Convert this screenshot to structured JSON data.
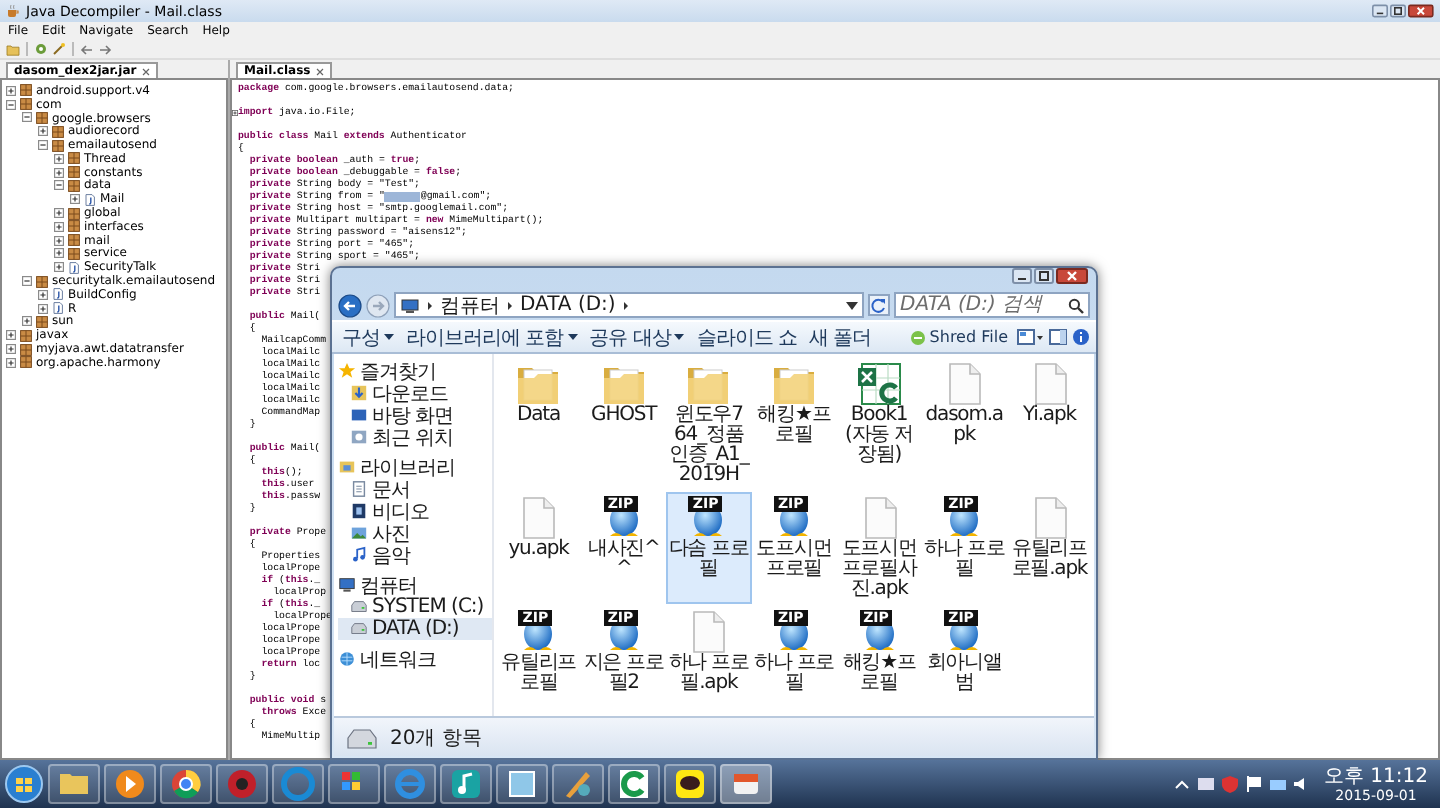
{
  "window": {
    "title": "Java Decompiler - Mail.class"
  },
  "menu": [
    "File",
    "Edit",
    "Navigate",
    "Search",
    "Help"
  ],
  "left_tab": {
    "label": "dasom_dex2jar.jar",
    "selected": true
  },
  "tree": [
    {
      "label": "android.support.v4",
      "kind": "package",
      "expanded": false
    },
    {
      "label": "com",
      "kind": "package",
      "expanded": true,
      "children": [
        {
          "label": "google.browsers",
          "kind": "package",
          "expanded": true,
          "children": [
            {
              "label": "audiorecord",
              "kind": "package",
              "expanded": false
            },
            {
              "label": "emailautosend",
              "kind": "package",
              "expanded": true,
              "children": [
                {
                  "label": "Thread",
                  "kind": "package",
                  "expanded": false
                },
                {
                  "label": "constants",
                  "kind": "package",
                  "expanded": false
                },
                {
                  "label": "data",
                  "kind": "package",
                  "expanded": true,
                  "children": [
                    {
                      "label": "Mail",
                      "kind": "class",
                      "expanded": false
                    }
                  ]
                },
                {
                  "label": "global",
                  "kind": "package",
                  "expanded": false
                },
                {
                  "label": "interfaces",
                  "kind": "package",
                  "expanded": false
                },
                {
                  "label": "mail",
                  "kind": "package",
                  "expanded": false
                },
                {
                  "label": "service",
                  "kind": "package",
                  "expanded": false
                },
                {
                  "label": "SecurityTalk",
                  "kind": "class",
                  "expanded": false
                }
              ]
            }
          ]
        },
        {
          "label": "securitytalk.emailautosend",
          "kind": "package",
          "expanded": true,
          "children": [
            {
              "label": "BuildConfig",
              "kind": "class",
              "expanded": false
            },
            {
              "label": "R",
              "kind": "class",
              "expanded": false
            }
          ]
        },
        {
          "label": "sun",
          "kind": "package",
          "expanded": false
        }
      ]
    },
    {
      "label": "javax",
      "kind": "package",
      "expanded": false
    },
    {
      "label": "myjava.awt.datatransfer",
      "kind": "package",
      "expanded": false
    },
    {
      "label": "org.apache.harmony",
      "kind": "package",
      "expanded": false
    }
  ],
  "editor_tab": {
    "label": "Mail.class",
    "selected": true
  },
  "code": {
    "blocks": [
      {
        "folded": false,
        "lines": [
          "**package** com.google.browsers.emailautosend.data;"
        ]
      },
      {
        "folded": true,
        "lines": [
          "**import** java.io.File;"
        ]
      },
      {
        "folded": false,
        "lines": [
          "**public class** Mail **extends** Authenticator",
          "{",
          "  **private boolean** _auth = **true**;",
          "  **private boolean** _debuggable = **false**;",
          "  **private** String body = \"Test\";",
          {
            "kind": "selection",
            "before": "  **private** String from = \"",
            "after": "@gmail.com\";"
          },
          "  **private** String host = \"smtp.googlemail.com\";",
          "  **private** Multipart multipart = **new** MimeMultipart();",
          "  **private** String password = \"aisens12\";",
          "  **private** String port = \"465\";",
          "  **private** String sport = \"465\";",
          "  **private** Stri",
          "  **private** Stri",
          "  **private** Stri"
        ]
      },
      {
        "folded": false,
        "lines": [
          "  **public** Mail(",
          "  {",
          "    MailcapComm",
          "    localMailc",
          "    localMailc",
          "    localMailc",
          "    localMailc",
          "    localMailc",
          "    CommandMap",
          "  }"
        ]
      },
      {
        "folded": false,
        "lines": [
          "  **public** Mail(",
          "  {",
          "    **this**();",
          "    **this**.user",
          "    **this**.passw",
          "  }"
        ]
      },
      {
        "folded": false,
        "lines": [
          "  **private** Prope",
          "  {",
          "    Properties",
          "    localPrope",
          "    **if** (**this**._",
          "      localProp",
          "    **if** (**this**._",
          "      localPrope",
          "    localPrope",
          "    localPrope",
          "    localPrope",
          "    **return** loc",
          "  }"
        ]
      },
      {
        "folded": false,
        "lines": [
          "  **public void** s",
          "    **throws** Exce",
          "  {",
          "    MimeMultip"
        ]
      }
    ]
  },
  "explorer": {
    "address": [
      "컴퓨터",
      "DATA (D:)"
    ],
    "search": {
      "placeholder": "DATA (D:) 검색"
    },
    "toolbar": [
      {
        "label": "구성",
        "dropdown": true
      },
      {
        "label": "라이브러리에 포함",
        "dropdown": true
      },
      {
        "label": "공유 대상",
        "dropdown": true
      },
      {
        "label": "슬라이드 쇼",
        "dropdown": false
      },
      {
        "label": "새 폴더",
        "dropdown": false
      }
    ],
    "shred_button": "Shred File",
    "nav": [
      {
        "label": "즐겨찾기",
        "kind": "favorites",
        "selected": false,
        "children": [
          {
            "label": "다운로드",
            "kind": "download",
            "selected": false
          },
          {
            "label": "바탕 화면",
            "kind": "desktop",
            "selected": false
          },
          {
            "label": "최근 위치",
            "kind": "recent",
            "selected": false
          }
        ]
      },
      {
        "label": "라이브러리",
        "kind": "library",
        "selected": false,
        "children": [
          {
            "label": "문서",
            "kind": "document",
            "selected": false
          },
          {
            "label": "비디오",
            "kind": "video",
            "selected": false
          },
          {
            "label": "사진",
            "kind": "picture",
            "selected": false
          },
          {
            "label": "음악",
            "kind": "music",
            "selected": false
          }
        ]
      },
      {
        "label": "컴퓨터",
        "kind": "computer",
        "selected": false,
        "children": [
          {
            "label": "SYSTEM (C:)",
            "kind": "drive",
            "selected": false
          },
          {
            "label": "DATA (D:)",
            "kind": "drive",
            "selected": true
          }
        ]
      },
      {
        "label": "네트워크",
        "kind": "network",
        "selected": false
      }
    ],
    "files": [
      {
        "label": "Data",
        "kind": "folder",
        "selected": false
      },
      {
        "label": "GHOST",
        "kind": "folder",
        "selected": false
      },
      {
        "label": "윈도우7 64_정품인증_A1_2019H",
        "kind": "folder",
        "selected": false
      },
      {
        "label": "해킹★프로필",
        "kind": "folder",
        "selected": false
      },
      {
        "label": "Book1 (자동 저장됨)",
        "kind": "excel",
        "selected": false
      },
      {
        "label": "dasom.apk",
        "kind": "file",
        "selected": false
      },
      {
        "label": "Yi.apk",
        "kind": "file",
        "selected": false
      },
      {
        "label": "yu.apk",
        "kind": "file",
        "selected": false
      },
      {
        "label": "내사진^^",
        "kind": "zip",
        "badge": "ZIP",
        "selected": false
      },
      {
        "label": "다솜 프로필",
        "kind": "zip",
        "badge": "ZIP",
        "selected": true
      },
      {
        "label": "도프시먼프로필",
        "kind": "zip",
        "badge": "ZIP",
        "selected": false
      },
      {
        "label": "도프시먼프로필사진.apk",
        "kind": "file",
        "selected": false
      },
      {
        "label": "하나 프로필",
        "kind": "zip",
        "badge": "ZIP",
        "selected": false
      },
      {
        "label": "유틸리프로필.apk",
        "kind": "file",
        "selected": false
      },
      {
        "label": "유틸리프로필",
        "kind": "zip",
        "badge": "ZIP",
        "selected": false
      },
      {
        "label": "지은 프로필2",
        "kind": "zip",
        "badge": "ZIP",
        "selected": false
      },
      {
        "label": "하나 프로필.apk",
        "kind": "file",
        "selected": false
      },
      {
        "label": "하나 프로필",
        "kind": "zip",
        "badge": "ZIP",
        "selected": false
      },
      {
        "label": "해킹★프로필",
        "kind": "zip",
        "badge": "ZIP",
        "selected": false
      },
      {
        "label": "회아니앨범",
        "kind": "zip",
        "badge": "ZIP",
        "selected": false
      }
    ],
    "status": "20개 항목"
  },
  "taskbar": {
    "clock": {
      "time": "오후 11:12",
      "date": "2015-09-01"
    }
  }
}
